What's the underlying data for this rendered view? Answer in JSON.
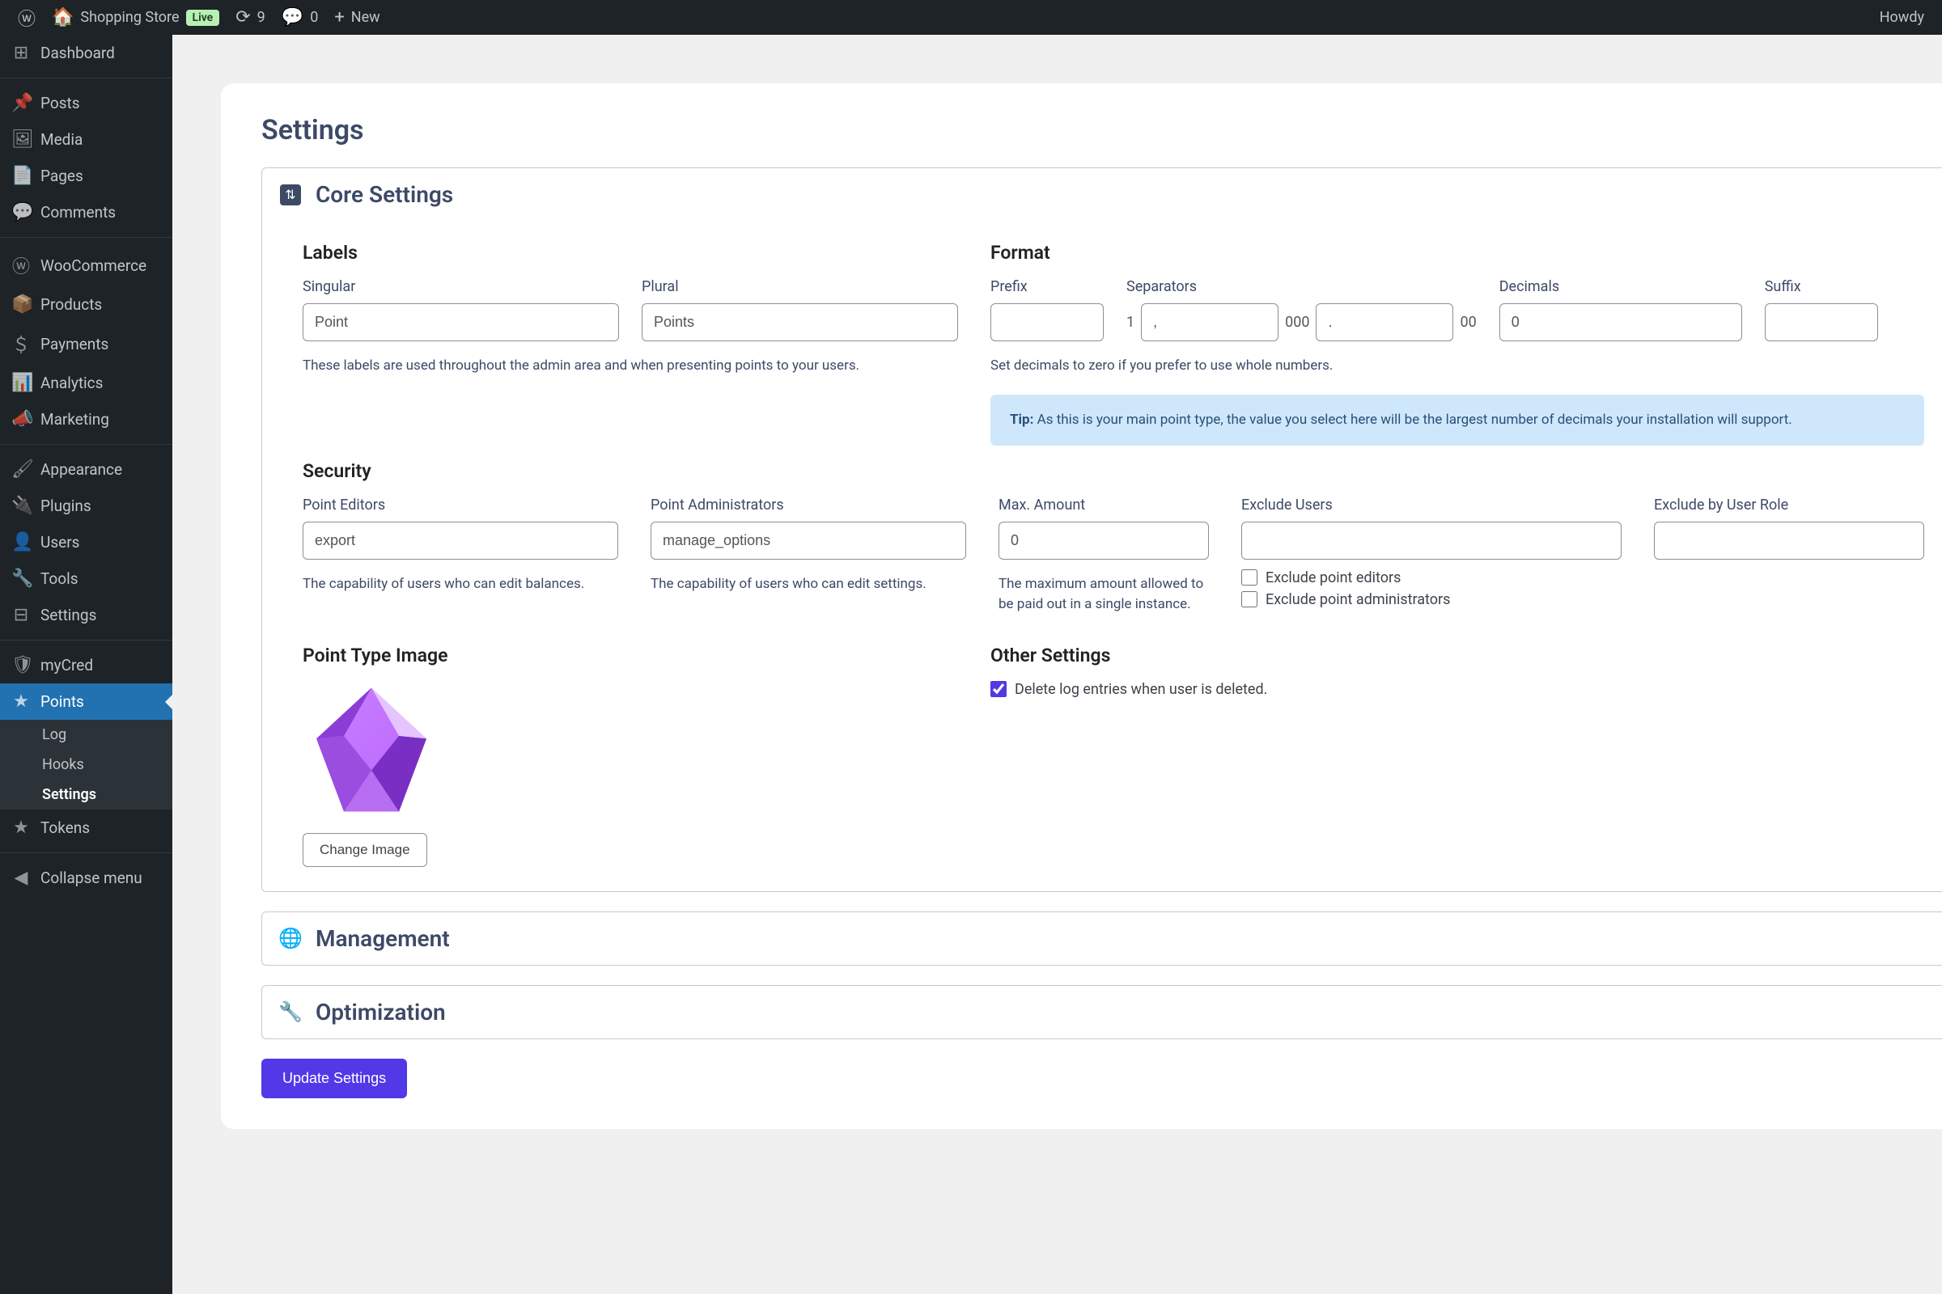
{
  "adminbar": {
    "site_name": "Shopping Store",
    "live_badge": "Live",
    "updates_count": "9",
    "comments_count": "0",
    "new_label": "New",
    "howdy": "Howdy"
  },
  "sidebar": {
    "items": [
      {
        "label": "Dashboard",
        "icon": "dashboard"
      },
      {
        "label": "Posts",
        "icon": "pin"
      },
      {
        "label": "Media",
        "icon": "media"
      },
      {
        "label": "Pages",
        "icon": "pages"
      },
      {
        "label": "Comments",
        "icon": "comment"
      },
      {
        "label": "WooCommerce",
        "icon": "woo"
      },
      {
        "label": "Products",
        "icon": "archive"
      },
      {
        "label": "Payments",
        "icon": "money"
      },
      {
        "label": "Analytics",
        "icon": "chart"
      },
      {
        "label": "Marketing",
        "icon": "megaphone"
      },
      {
        "label": "Appearance",
        "icon": "brush"
      },
      {
        "label": "Plugins",
        "icon": "plug"
      },
      {
        "label": "Users",
        "icon": "user"
      },
      {
        "label": "Tools",
        "icon": "wrench"
      },
      {
        "label": "Settings",
        "icon": "sliders"
      },
      {
        "label": "myCred",
        "icon": "shield"
      },
      {
        "label": "Points",
        "icon": "star"
      },
      {
        "label": "Tokens",
        "icon": "star"
      },
      {
        "label": "Collapse menu",
        "icon": "collapse"
      }
    ],
    "submenu": [
      {
        "label": "Log"
      },
      {
        "label": "Hooks"
      },
      {
        "label": "Settings"
      }
    ]
  },
  "page": {
    "title": "Settings",
    "update_button": "Update Settings"
  },
  "core": {
    "title": "Core Settings",
    "labels": {
      "heading": "Labels",
      "singular_lbl": "Singular",
      "singular_val": "Point",
      "plural_lbl": "Plural",
      "plural_val": "Points",
      "help": "These labels are used throughout the admin area and when presenting points to your users."
    },
    "format": {
      "heading": "Format",
      "prefix_lbl": "Prefix",
      "prefix_val": "",
      "sep_lbl": "Separators",
      "sep_one": "1",
      "sep_thou_val": ",",
      "sep_thou": "000",
      "sep_dec_val": ".",
      "sep_dec": "00",
      "dec_lbl": "Decimals",
      "dec_val": "0",
      "suffix_lbl": "Suffix",
      "suffix_val": "",
      "help": "Set decimals to zero if you prefer to use whole numbers.",
      "tip_label": "Tip:",
      "tip": "As this is your main point type, the value you select here will be the largest number of decimals your installation will support."
    },
    "security": {
      "heading": "Security",
      "editors_lbl": "Point Editors",
      "editors_val": "export",
      "editors_help": "The capability of users who can edit balances.",
      "admins_lbl": "Point Administrators",
      "admins_val": "manage_options",
      "admins_help": "The capability of users who can edit settings.",
      "max_lbl": "Max. Amount",
      "max_val": "0",
      "max_help": "The maximum amount allowed to be paid out in a single instance.",
      "excl_users_lbl": "Exclude Users",
      "excl_role_lbl": "Exclude by User Role",
      "chk_editors": "Exclude point editors",
      "chk_admins": "Exclude point administrators"
    },
    "pt_image": {
      "heading": "Point Type Image",
      "change_btn": "Change Image"
    },
    "other": {
      "heading": "Other Settings",
      "delete_log": "Delete log entries when user is deleted."
    }
  },
  "accordions": {
    "management": "Management",
    "optimization": "Optimization"
  }
}
